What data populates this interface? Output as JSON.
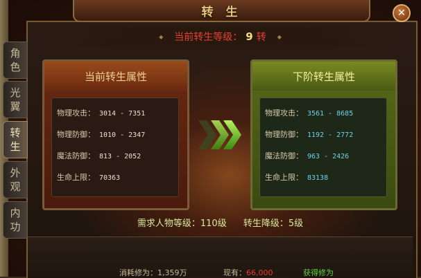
{
  "window": {
    "title": "转 生",
    "close_glyph": "✕"
  },
  "level_bar": {
    "label": "当前转生等级：",
    "value": "9",
    "unit": "转"
  },
  "tabs": [
    {
      "line1": "角",
      "line2": "色",
      "active": false
    },
    {
      "line1": "光",
      "line2": "翼",
      "active": false
    },
    {
      "line1": "转",
      "line2": "生",
      "active": true
    },
    {
      "line1": "外",
      "line2": "观",
      "active": false
    },
    {
      "line1": "内",
      "line2": "功",
      "active": false
    }
  ],
  "current": {
    "title": "当前转生属性",
    "rows": [
      {
        "label": "物理攻击：",
        "value": "3014 - 7351"
      },
      {
        "label": "物理防御：",
        "value": "1010 - 2347"
      },
      {
        "label": "魔法防御：",
        "value": "813 - 2052"
      },
      {
        "label": "生命上限：",
        "value": "70363"
      }
    ]
  },
  "next": {
    "title": "下阶转生属性",
    "rows": [
      {
        "label": "物理攻击：",
        "value": "3561 - 8685"
      },
      {
        "label": "物理防御：",
        "value": "1192 - 2772"
      },
      {
        "label": "魔法防御：",
        "value": "963 - 2426"
      },
      {
        "label": "生命上限：",
        "value": "83138"
      }
    ]
  },
  "requirements": {
    "level": "需求人物等级：110级",
    "drop": "转生降级：5级"
  },
  "cost": {
    "consume": "消耗修为：1,359万",
    "have_label": "现有：",
    "have_value": "66,000",
    "obtain_link": "获得修为"
  },
  "colors": {
    "next_value": "#70d0e8",
    "have_value": "#e83a2a",
    "link": "#60d040"
  }
}
